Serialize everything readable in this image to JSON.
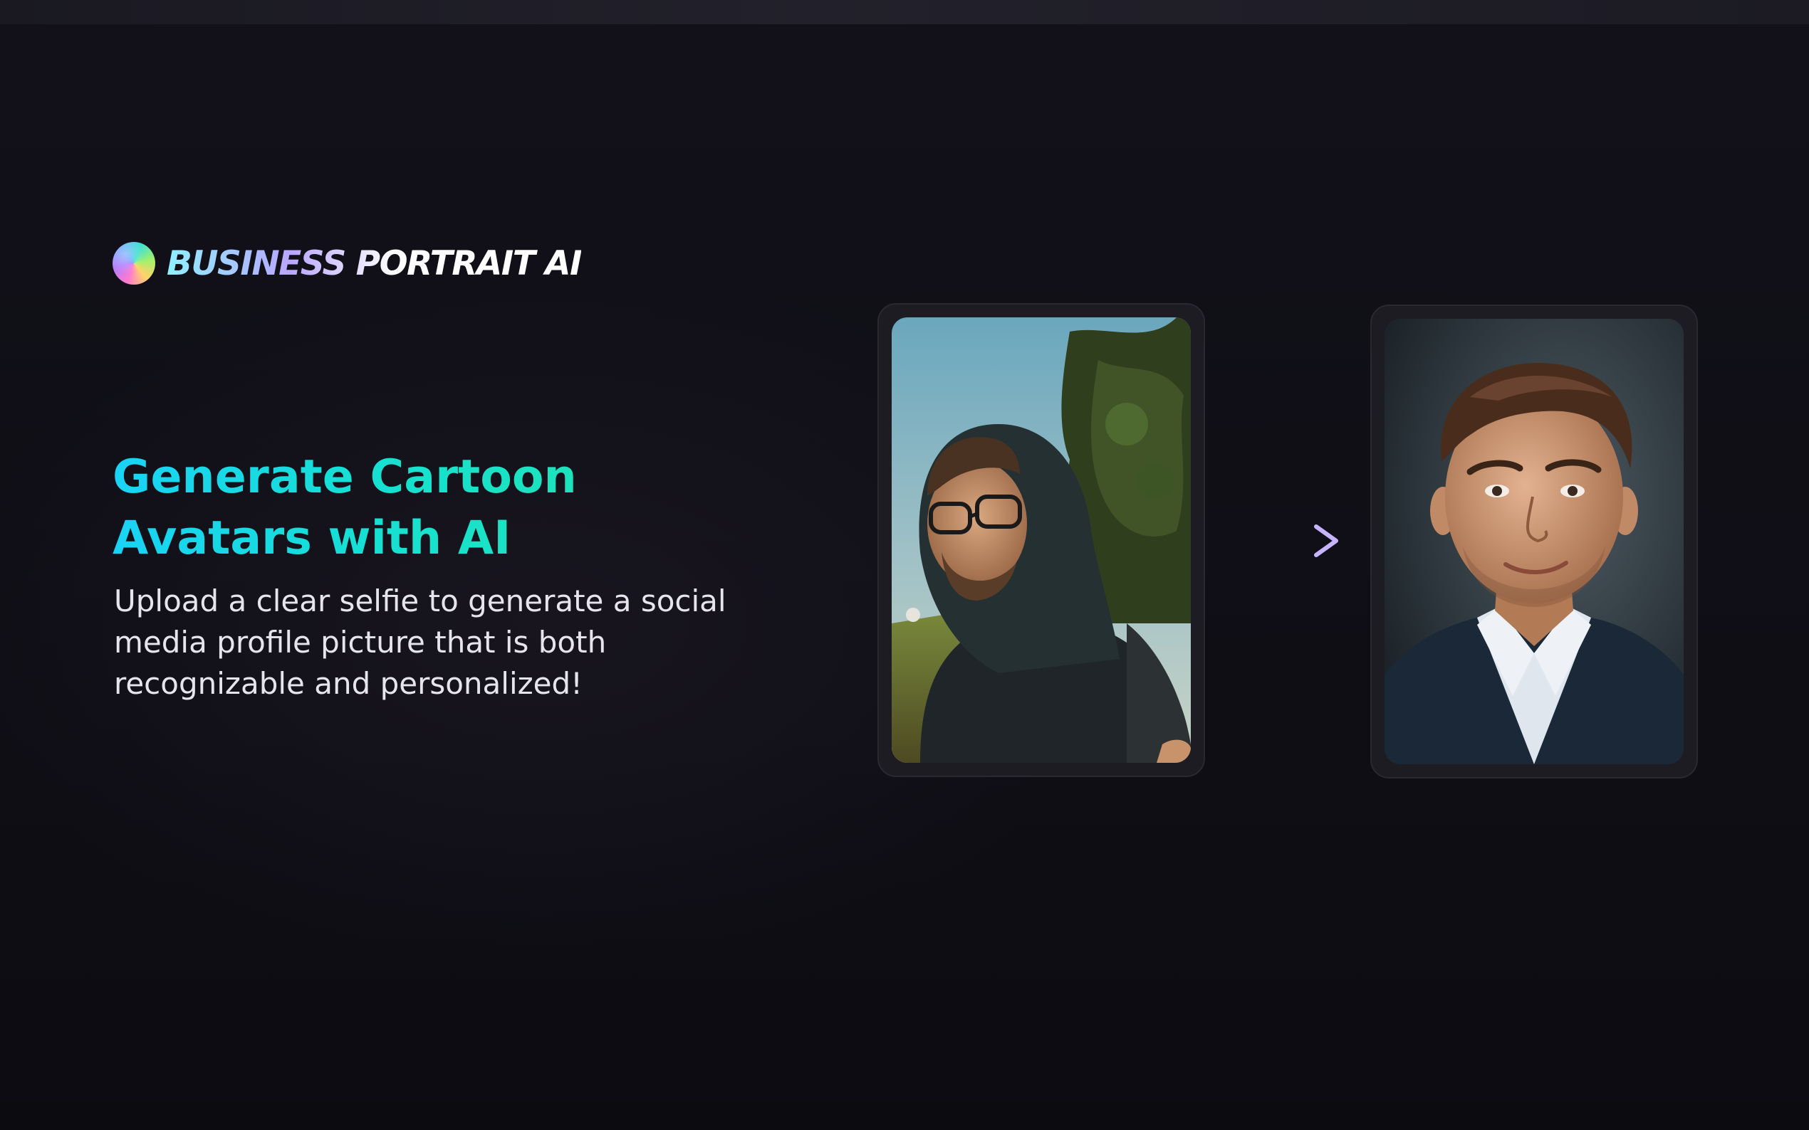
{
  "brand": {
    "name": "BUSINESS PORTRAIT AI",
    "logo_icon": "gradient-orb-icon"
  },
  "hero": {
    "headline_line1": "Generate Cartoon",
    "headline_line2": "Avatars with AI",
    "subtitle_line1": "Upload a clear selfie to generate a social",
    "subtitle_line2": "media profile picture that is both",
    "subtitle_line3": "recognizable and personalized!"
  },
  "showcase": {
    "input_photo": "selfie-outdoor-hoodie-photo",
    "arrow_icon": "dashed-arrow-right-icon",
    "output_photo": "business-portrait-suit-photo"
  },
  "colors": {
    "background": "#100f17",
    "headline_start": "#19d3f5",
    "headline_end": "#22e6a8",
    "arrow": "#b9a3f0",
    "frame": "#1d1c22"
  }
}
